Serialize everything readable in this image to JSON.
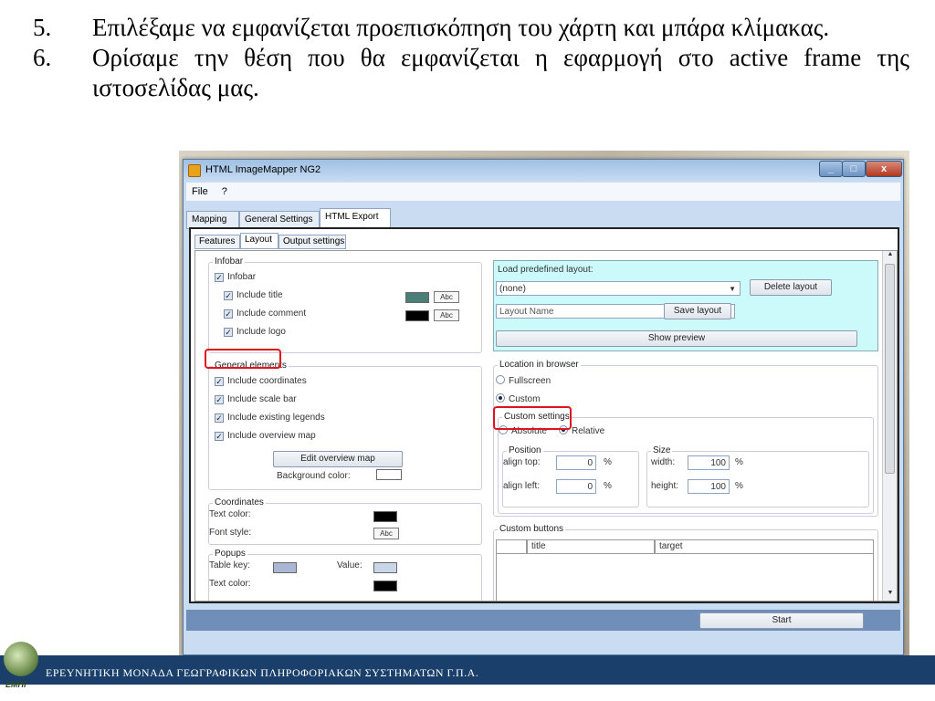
{
  "slide": {
    "item5_number": "5.",
    "item5_text": "Επιλέξαμε να εμφανίζεται προεπισκόπηση του χάρτη και μπάρα κλίμακας.",
    "item6_number": "6.",
    "item6_text": "Ορίσαμε την θέση που θα εμφανίζεται η εφαρμογή στο active frame της ιστοσελίδας μας.",
    "footer": "ΕΡΕΥΝΗΤΙΚΗ ΜΟΝΑΔΑ ΓΕΩΓΡΑΦΙΚΩΝ ΠΛΗΡΟΦΟΡΙΑΚΩΝ ΣΥΣΤΗΜΑΤΩΝ Γ.Π.Α.",
    "logo_text": "ΕΜΠΓ"
  },
  "window": {
    "title": "HTML ImageMapper NG2",
    "minimize": "_",
    "maximize": "□",
    "close": "x"
  },
  "menu": {
    "file": "File",
    "help": "?"
  },
  "main_tabs": {
    "mapping": "Mapping",
    "general": "General Settings",
    "export": "HTML Export"
  },
  "sub_tabs": {
    "features": "Features",
    "layout": "Layout",
    "output": "Output settings"
  },
  "infobar": {
    "group": "Infobar",
    "infobar": "Infobar",
    "include_title": "Include title",
    "include_comment": "Include comment",
    "include_logo": "Include logo",
    "abc": "Abc",
    "title_color": "#4a7f78",
    "comment_color": "#000000"
  },
  "general": {
    "group": "General elements",
    "coordinates": "Include coordinates",
    "scale_bar": "Include scale bar",
    "legends": "Include existing legends",
    "overview": "Include overview map",
    "edit_overview": "Edit overview map",
    "bg_color": "Background color:"
  },
  "coordinates": {
    "group": "Coordinates",
    "text_color": "Text color:",
    "font_style": "Font style:",
    "abc": "Abc"
  },
  "popups": {
    "group": "Popups",
    "table_key": "Table key:",
    "value": "Value:",
    "text_color": "Text color:",
    "key_color": "#a9b6d4",
    "value_color": "#c9d6ea"
  },
  "layout": {
    "load_label": "Load predefined layout:",
    "selected": "(none)",
    "delete": "Delete layout",
    "name_placeholder": "Layout Name",
    "save": "Save layout",
    "show_preview": "Show preview"
  },
  "location": {
    "group": "Location in browser",
    "fullscreen": "Fullscreen",
    "custom": "Custom",
    "custom_settings": "Custom settings",
    "absolute": "Absolute",
    "relative": "Relative",
    "position": "Position",
    "align_top": "align top:",
    "align_top_value": "0",
    "align_left": "align left:",
    "align_left_value": "0",
    "size": "Size",
    "width": "width:",
    "width_value": "100",
    "height": "height:",
    "height_value": "100",
    "pct": "%"
  },
  "custom_buttons": {
    "group": "Custom buttons",
    "col_title": "title",
    "col_target": "target"
  },
  "bottom": {
    "start": "Start"
  }
}
